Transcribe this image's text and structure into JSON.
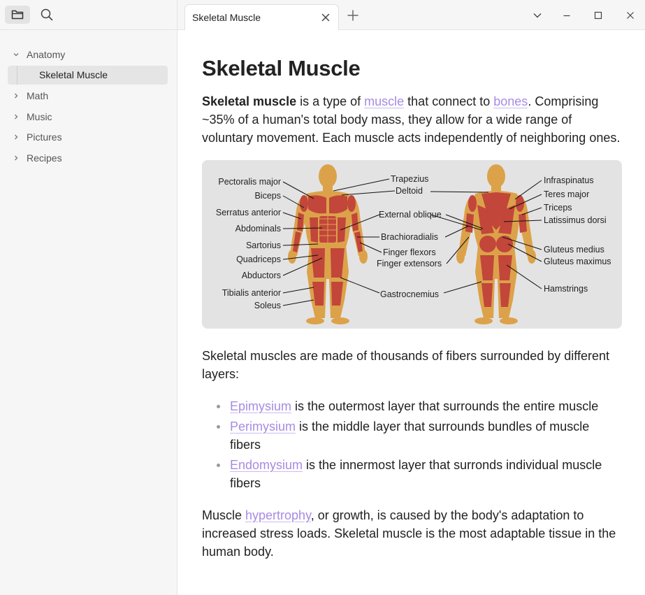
{
  "sidebar": {
    "tree": [
      {
        "label": "Anatomy",
        "expanded": true,
        "children": [
          {
            "label": "Skeletal Muscle"
          }
        ]
      },
      {
        "label": "Math"
      },
      {
        "label": "Music"
      },
      {
        "label": "Pictures"
      },
      {
        "label": "Recipes"
      }
    ]
  },
  "tabs": [
    {
      "label": "Skeletal Muscle"
    }
  ],
  "article": {
    "title": "Skeletal Muscle",
    "intro": {
      "bold": "Skeletal muscle",
      "t1": " is a type of ",
      "link1": "muscle",
      "t2": " that connect to ",
      "link2": "bones",
      "t3": ". Comprising ~35% of a human's total body mass, they allow for a wide range of voluntary movement. Each muscle acts independently of neighboring ones."
    },
    "figure": {
      "left_labels": [
        "Pectoralis major",
        "Biceps",
        "Serratus anterior",
        "Abdominals",
        "Sartorius",
        "Quadriceps",
        "Abductors",
        "Tibialis anterior",
        "Soleus"
      ],
      "center_labels": [
        "Trapezius",
        "Deltoid",
        "External oblique",
        "Brachioradialis",
        "Finger flexors",
        "Finger extensors",
        "Gastrocnemius"
      ],
      "right_labels": [
        "Infraspinatus",
        "Teres major",
        "Triceps",
        "Latissimus dorsi",
        "Gluteus medius",
        "Gluteus maximus",
        "Hamstrings"
      ],
      "colors": {
        "skin": "#dca24a",
        "muscle": "#c2463a",
        "background": "#e3e3e3"
      }
    },
    "para2": "Skeletal muscles are made of thousands of fibers surrounded by different layers:",
    "layers": [
      {
        "link": "Epimysium",
        "text": " is the outermost layer that surrounds the entire muscle"
      },
      {
        "link": "Perimysium",
        "text": " is the middle layer that surrounds bundles of muscle fibers"
      },
      {
        "link": "Endomysium",
        "text": " is the innermost layer that surronds individual muscle fibers"
      }
    ],
    "para3": {
      "t1": "Muscle ",
      "link": "hypertrophy",
      "t2": ", or growth, is caused by the body's adaptation to increased stress loads. Skeletal muscle is the most adaptable tissue in the human body."
    }
  },
  "colors": {
    "link": "#a88be2",
    "sidebar_bg": "#f6f6f6",
    "selected_bg": "#e5e5e5"
  }
}
